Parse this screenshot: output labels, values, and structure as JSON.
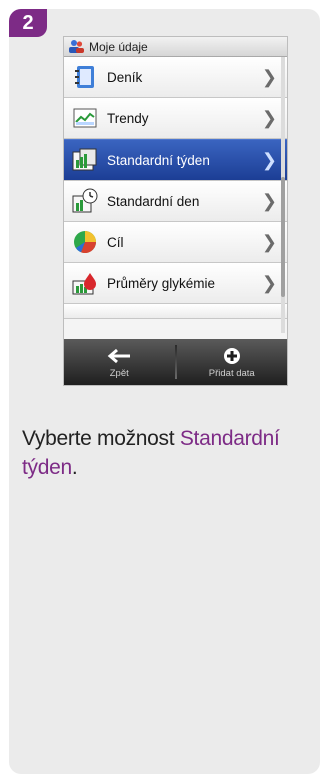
{
  "step": {
    "number": "2"
  },
  "device": {
    "header": {
      "title": "Moje údaje",
      "icon": "user-group-icon"
    },
    "menu": [
      {
        "label": "Deník",
        "icon": "logbook-icon"
      },
      {
        "label": "Trendy",
        "icon": "trend-chart-icon"
      },
      {
        "label": "Standardní týden",
        "icon": "standard-week-icon",
        "selected": true
      },
      {
        "label": "Standardní den",
        "icon": "standard-day-icon"
      },
      {
        "label": "Cíl",
        "icon": "target-pie-icon"
      },
      {
        "label": "Průměry glykémie",
        "icon": "glucose-averages-icon"
      }
    ],
    "footer": {
      "back_label": "Zpět",
      "add_label": "Přidat data"
    }
  },
  "instruction": {
    "prefix": "Vyberte možnost ",
    "highlight": "Standardní týden",
    "suffix": "."
  },
  "colors": {
    "accent": "#7d2b86",
    "selected": "#2a50aa"
  }
}
